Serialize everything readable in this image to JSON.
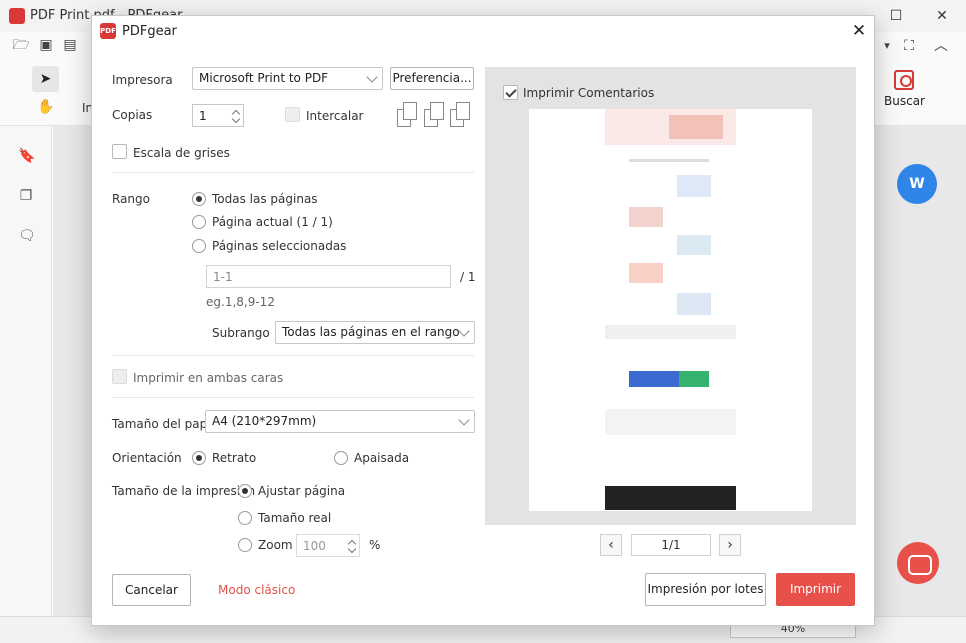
{
  "app": {
    "title": "PDF Print.pdf - PDFgear",
    "search_label": "Buscar",
    "zoom": "40%",
    "toolbar_partial_label": "In"
  },
  "dialog": {
    "title": "PDFgear",
    "printer_label": "Impresora",
    "printer_value": "Microsoft Print to PDF",
    "preferences_label": "Preferencia...",
    "copies_label": "Copias",
    "copies_value": "1",
    "collate_label": "Intercalar",
    "grayscale_label": "Escala de grises",
    "range_label": "Rango",
    "range_options": [
      "Todas las páginas",
      "Página actual (1 / 1)",
      "Páginas seleccionadas"
    ],
    "range_selected": 0,
    "pages_input_placeholder": "1-1",
    "pages_total": "/ 1",
    "pages_example": "eg.1,8,9-12",
    "subrange_label": "Subrango",
    "subrange_value": "Todas las páginas en el rango",
    "duplex_label": "Imprimir en ambas caras",
    "paper_label": "Tamaño del papel",
    "paper_value": "A4 (210*297mm)",
    "orientation_label": "Orientación",
    "orientation_options": [
      "Retrato",
      "Apaisada"
    ],
    "orientation_selected": 0,
    "print_size_label": "Tamaño de la impresión",
    "print_size_options": [
      "Ajustar página",
      "Tamaño real",
      "Zoom"
    ],
    "print_size_selected": 0,
    "zoom_value": "100",
    "zoom_unit": "%",
    "print_comments_label": "Imprimir Comentarios",
    "print_comments_checked": true,
    "page_indicator": "1/1",
    "cancel_label": "Cancelar",
    "classic_mode_label": "Modo clásico",
    "batch_print_label": "Impresión por lotes",
    "print_label": "Imprimir"
  },
  "colors": {
    "accent": "#e8504a",
    "brand_red": "#d93838",
    "word_fab": "#2f86e8"
  }
}
